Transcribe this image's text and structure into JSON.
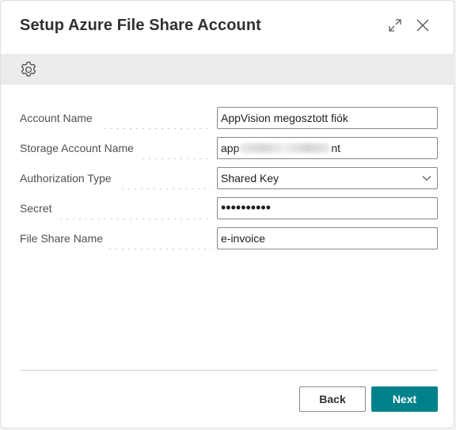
{
  "dialog": {
    "title": "Setup Azure File Share Account"
  },
  "icons": {
    "expand": "expand-icon",
    "close": "close-icon",
    "settings": "gear-icon",
    "dropdown": "chevron-down-icon"
  },
  "form": {
    "fields": [
      {
        "label": "Account Name",
        "value": "AppVision megosztott fiók"
      },
      {
        "label": "Storage Account Name",
        "value_prefix": "app",
        "value_suffix": "nt"
      },
      {
        "label": "Authorization Type",
        "value": "Shared Key"
      },
      {
        "label": "Secret",
        "value": "••••••••••"
      },
      {
        "label": "File Share Name",
        "value": "e-invoice"
      }
    ]
  },
  "footer": {
    "back_label": "Back",
    "next_label": "Next"
  },
  "colors": {
    "accent": "#00828a",
    "action_bar": "#ececec",
    "border": "#8a8886"
  }
}
